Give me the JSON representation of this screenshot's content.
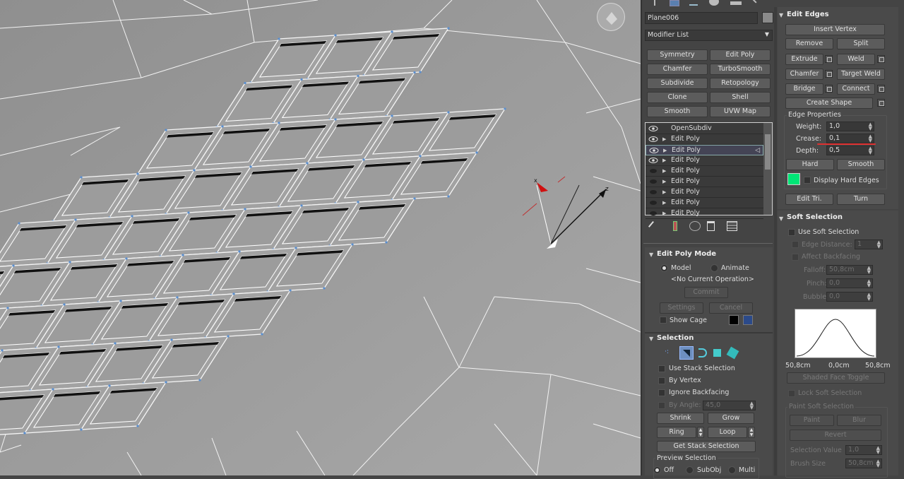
{
  "object": {
    "name": "Plane006"
  },
  "modifier_list": {
    "label": "Modifier List"
  },
  "modifier_buttons": [
    "Symmetry",
    "Edit Poly",
    "Chamfer",
    "TurboSmooth",
    "Subdivide",
    "Retopology",
    "Clone",
    "Shell",
    "Smooth",
    "UVW Map"
  ],
  "stack": {
    "items": [
      {
        "label": "OpenSubdiv",
        "eye": "on",
        "expand": false
      },
      {
        "label": "Edit Poly",
        "eye": "on",
        "expand": true
      },
      {
        "label": "Edit Poly",
        "eye": "on",
        "expand": true,
        "selected": true
      },
      {
        "label": "Edit Poly",
        "eye": "on",
        "expand": true
      },
      {
        "label": "Edit Poly",
        "eye": "off",
        "expand": true
      },
      {
        "label": "Edit Poly",
        "eye": "off",
        "expand": true
      },
      {
        "label": "Edit Poly",
        "eye": "off",
        "expand": true
      },
      {
        "label": "Edit Poly",
        "eye": "off",
        "expand": true
      },
      {
        "label": "Edit Poly",
        "eye": "off",
        "expand": true
      }
    ]
  },
  "edit_poly_mode": {
    "title": "Edit Poly Mode",
    "model": "Model",
    "animate": "Animate",
    "current_op": "<No Current Operation>",
    "commit": "Commit",
    "settings": "Settings",
    "cancel": "Cancel",
    "show_cage": "Show Cage",
    "cage_colors": [
      "#000000",
      "#2b4a8a"
    ]
  },
  "selection": {
    "title": "Selection",
    "use_stack": "Use Stack Selection",
    "by_vertex": "By Vertex",
    "ignore_backfacing": "Ignore Backfacing",
    "by_angle": "By Angle:",
    "by_angle_value": "45,0",
    "shrink": "Shrink",
    "grow": "Grow",
    "ring": "Ring",
    "loop": "Loop",
    "get_stack": "Get Stack Selection",
    "preview": "Preview Selection",
    "off": "Off",
    "subobj": "SubObj",
    "multi": "Multi"
  },
  "edit_edges": {
    "title": "Edit Edges",
    "insert_vertex": "Insert Vertex",
    "remove": "Remove",
    "split": "Split",
    "extrude": "Extrude",
    "weld": "Weld",
    "chamfer": "Chamfer",
    "target_weld": "Target Weld",
    "bridge": "Bridge",
    "connect": "Connect",
    "create_shape": "Create Shape",
    "edge_properties": "Edge Properties",
    "weight_label": "Weight:",
    "weight": "1,0",
    "crease_label": "Crease:",
    "crease": "0,1",
    "depth_label": "Depth:",
    "depth": "0,5",
    "hard": "Hard",
    "smooth": "Smooth",
    "display_hard_edges": "Display Hard Edges",
    "hard_edge_color": "#00e676",
    "edit_tri": "Edit Tri.",
    "turn": "Turn"
  },
  "soft_selection": {
    "title": "Soft Selection",
    "use_soft": "Use Soft Selection",
    "edge_distance": "Edge Distance:",
    "edge_distance_value": "1",
    "affect_backfacing": "Affect Backfacing",
    "falloff": "Falloff:",
    "falloff_value": "50,8cm",
    "pinch": "Pinch:",
    "pinch_value": "0,0",
    "bubble": "Bubble:",
    "bubble_value": "0,0",
    "curve_left": "50,8cm",
    "curve_mid": "0,0cm",
    "curve_right": "50,8cm",
    "shaded_face_toggle": "Shaded Face Toggle",
    "lock_soft": "Lock Soft Selection",
    "paint_soft": "Paint Soft Selection",
    "paint": "Paint",
    "blur": "Blur",
    "revert": "Revert",
    "selection_value": "Selection Value",
    "selection_value_value": "1,0",
    "brush_size": "Brush Size",
    "brush_size_value": "50,8cm"
  },
  "gizmo": {
    "z_label": "z",
    "x_label": "x"
  },
  "colors": {
    "viewport_bg": "#9a9a9a",
    "wire": "#ffffff",
    "vertex": "#5a8fd0",
    "panel": "#444444"
  }
}
